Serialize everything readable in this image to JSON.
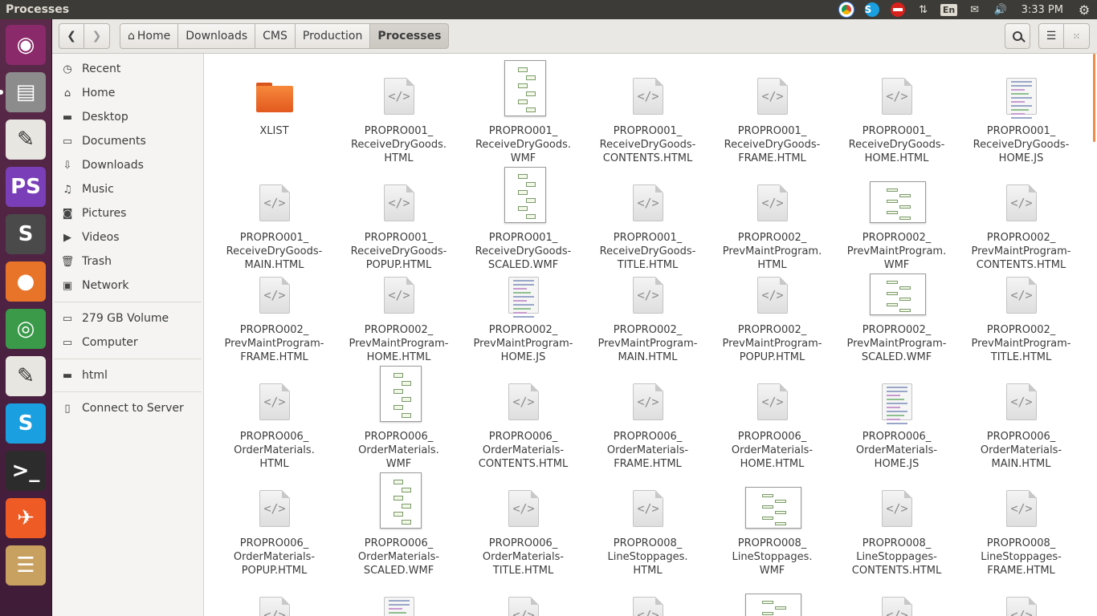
{
  "window": {
    "title": "Processes"
  },
  "indicators": {
    "clock": "3:33 PM",
    "keyboard": "En"
  },
  "launcher": {
    "items": [
      {
        "name": "ubuntu-dash-icon",
        "glyph": "◉",
        "bg": "#8a2a6a"
      },
      {
        "name": "files-app-icon",
        "glyph": "▤",
        "bg": "#8c8c8c"
      },
      {
        "name": "text-editor-icon",
        "glyph": "✎",
        "bg": "#e8e6e0"
      },
      {
        "name": "phpstorm-icon",
        "glyph": "PS",
        "bg": "#7a3fb8"
      },
      {
        "name": "sublime-text-icon",
        "glyph": "S",
        "bg": "#4a4a4a"
      },
      {
        "name": "firefox-icon",
        "glyph": "●",
        "bg": "#e8742a"
      },
      {
        "name": "chrome-icon",
        "glyph": "◎",
        "bg": "#3a9a4a"
      },
      {
        "name": "text-editor-2-icon",
        "glyph": "✎",
        "bg": "#e8e6e0"
      },
      {
        "name": "skype-icon",
        "glyph": "S",
        "bg": "#1a9fe0"
      },
      {
        "name": "terminal-icon",
        "glyph": ">_",
        "bg": "#2c2c2c"
      },
      {
        "name": "postman-icon",
        "glyph": "✈",
        "bg": "#ef5b25"
      },
      {
        "name": "apps-stack-icon",
        "glyph": "☰",
        "bg": "#c8a060"
      }
    ]
  },
  "breadcrumbs": [
    "Home",
    "Downloads",
    "CMS",
    "Production",
    "Processes"
  ],
  "sidebar": {
    "group1": [
      {
        "name": "recent",
        "icon": "◷",
        "label": "Recent"
      },
      {
        "name": "home",
        "icon": "⌂",
        "label": "Home"
      },
      {
        "name": "desktop",
        "icon": "▬",
        "label": "Desktop"
      },
      {
        "name": "documents",
        "icon": "▭",
        "label": "Documents"
      },
      {
        "name": "downloads",
        "icon": "⇩",
        "label": "Downloads"
      },
      {
        "name": "music",
        "icon": "♫",
        "label": "Music"
      },
      {
        "name": "pictures",
        "icon": "◙",
        "label": "Pictures"
      },
      {
        "name": "videos",
        "icon": "▶",
        "label": "Videos"
      },
      {
        "name": "trash",
        "icon": "🗑",
        "label": "Trash"
      },
      {
        "name": "network",
        "icon": "▣",
        "label": "Network"
      }
    ],
    "group2": [
      {
        "name": "volume",
        "icon": "▭",
        "label": "279 GB Volume"
      },
      {
        "name": "computer",
        "icon": "▭",
        "label": "Computer"
      }
    ],
    "group3": [
      {
        "name": "html",
        "icon": "▬",
        "label": "html"
      }
    ],
    "group4": [
      {
        "name": "connect",
        "icon": "▯",
        "label": "Connect to Server"
      }
    ]
  },
  "files": [
    {
      "label": "XLIST",
      "type": "folder"
    },
    {
      "label": "PROPRO001_\nReceiveDryGoods.\nHTML",
      "type": "html"
    },
    {
      "label": "PROPRO001_\nReceiveDryGoods.\nWMF",
      "type": "wmf"
    },
    {
      "label": "PROPRO001_\nReceiveDryGoods-\nCONTENTS.HTML",
      "type": "html"
    },
    {
      "label": "PROPRO001_\nReceiveDryGoods-\nFRAME.HTML",
      "type": "html"
    },
    {
      "label": "PROPRO001_\nReceiveDryGoods-\nHOME.HTML",
      "type": "html"
    },
    {
      "label": "PROPRO001_\nReceiveDryGoods-\nHOME.JS",
      "type": "js"
    },
    {
      "label": "PROPRO001_\nReceiveDryGoods-\nMAIN.HTML",
      "type": "html"
    },
    {
      "label": "PROPRO001_\nReceiveDryGoods-\nPOPUP.HTML",
      "type": "html"
    },
    {
      "label": "PROPRO001_\nReceiveDryGoods-\nSCALED.WMF",
      "type": "wmf"
    },
    {
      "label": "PROPRO001_\nReceiveDryGoods-\nTITLE.HTML",
      "type": "html"
    },
    {
      "label": "PROPRO002_\nPrevMaintProgram.\nHTML",
      "type": "html"
    },
    {
      "label": "PROPRO002_\nPrevMaintProgram.\nWMF",
      "type": "wmf-wide"
    },
    {
      "label": "PROPRO002_\nPrevMaintProgram-\nCONTENTS.HTML",
      "type": "html"
    },
    {
      "label": "PROPRO002_\nPrevMaintProgram-\nFRAME.HTML",
      "type": "html"
    },
    {
      "label": "PROPRO002_\nPrevMaintProgram-\nHOME.HTML",
      "type": "html"
    },
    {
      "label": "PROPRO002_\nPrevMaintProgram-\nHOME.JS",
      "type": "js"
    },
    {
      "label": "PROPRO002_\nPrevMaintProgram-\nMAIN.HTML",
      "type": "html"
    },
    {
      "label": "PROPRO002_\nPrevMaintProgram-\nPOPUP.HTML",
      "type": "html"
    },
    {
      "label": "PROPRO002_\nPrevMaintProgram-\nSCALED.WMF",
      "type": "wmf-wide"
    },
    {
      "label": "PROPRO002_\nPrevMaintProgram-\nTITLE.HTML",
      "type": "html"
    },
    {
      "label": "PROPRO006_\nOrderMaterials.\nHTML",
      "type": "html"
    },
    {
      "label": "PROPRO006_\nOrderMaterials.\nWMF",
      "type": "wmf"
    },
    {
      "label": "PROPRO006_\nOrderMaterials-\nCONTENTS.HTML",
      "type": "html"
    },
    {
      "label": "PROPRO006_\nOrderMaterials-\nFRAME.HTML",
      "type": "html"
    },
    {
      "label": "PROPRO006_\nOrderMaterials-\nHOME.HTML",
      "type": "html"
    },
    {
      "label": "PROPRO006_\nOrderMaterials-\nHOME.JS",
      "type": "js"
    },
    {
      "label": "PROPRO006_\nOrderMaterials-\nMAIN.HTML",
      "type": "html"
    },
    {
      "label": "PROPRO006_\nOrderMaterials-\nPOPUP.HTML",
      "type": "html"
    },
    {
      "label": "PROPRO006_\nOrderMaterials-\nSCALED.WMF",
      "type": "wmf"
    },
    {
      "label": "PROPRO006_\nOrderMaterials-\nTITLE.HTML",
      "type": "html"
    },
    {
      "label": "PROPRO008_\nLineStoppages.\nHTML",
      "type": "html"
    },
    {
      "label": "PROPRO008_\nLineStoppages.\nWMF",
      "type": "wmf-wide"
    },
    {
      "label": "PROPRO008_\nLineStoppages-\nCONTENTS.HTML",
      "type": "html"
    },
    {
      "label": "PROPRO008_\nLineStoppages-\nFRAME.HTML",
      "type": "html"
    },
    {
      "label": "",
      "type": "html"
    },
    {
      "label": "",
      "type": "js"
    },
    {
      "label": "",
      "type": "html"
    },
    {
      "label": "",
      "type": "html"
    },
    {
      "label": "",
      "type": "wmf-wide"
    },
    {
      "label": "",
      "type": "html"
    },
    {
      "label": "",
      "type": "html"
    }
  ]
}
